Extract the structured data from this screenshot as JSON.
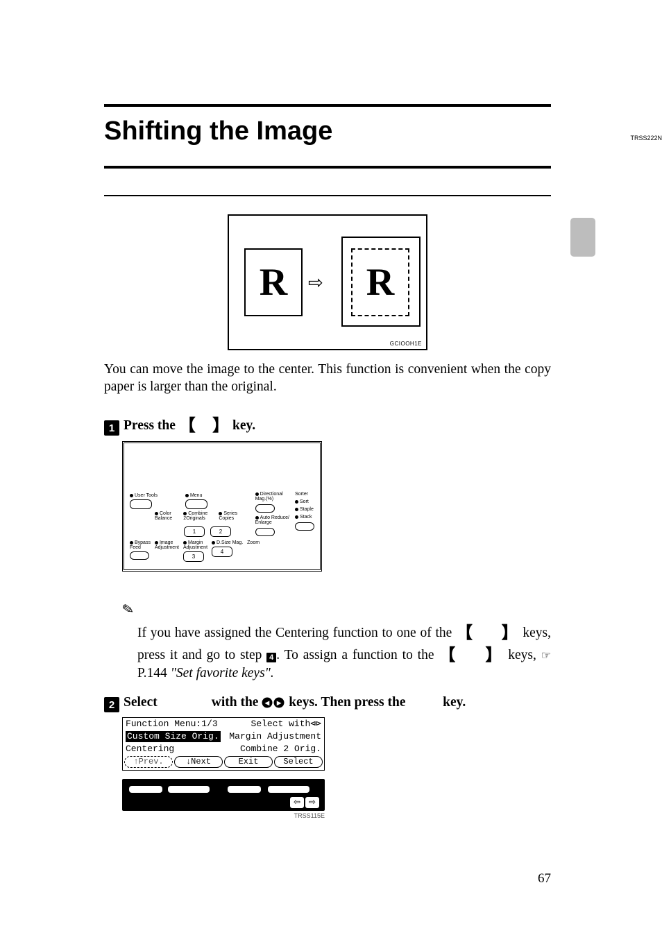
{
  "title": "Shifting the Image",
  "figure": {
    "letter_left": "R",
    "letter_right": "R",
    "code": "GCIOOH1E"
  },
  "intro": "You can move the image to the center. This function is convenient when the copy paper is larger than the original.",
  "step1": {
    "num": "1",
    "prefix": "Press the ",
    "suffix": " key."
  },
  "panel_code": "TRSS222N",
  "panel": {
    "user_tools": "User Tools",
    "menu": "Menu",
    "color_balance": "Color\nBalance",
    "combine": "Combine\n2Originals",
    "series": "Series\nCopies",
    "bypass": "Bypass\nFeed",
    "image_adj": "Image\nAdjustment",
    "margin_adj": "Margin\nAdjustment",
    "dsize": "D.Size Mag.",
    "n1": "1",
    "n2": "2",
    "n3": "3",
    "n4": "4",
    "directional": "Directional\nMag.(%)",
    "auto_reduce": "Auto Reduce/\nEnlarge",
    "zoom": "Zoom",
    "sorter": "Sorter",
    "sort": "Sort",
    "staple": "Staple",
    "stack": "Stack"
  },
  "note": {
    "line1a": "If you have assigned the Centering function to one of the ",
    "line1b": " keys,",
    "line2a": "press it and go to step ",
    "step_ref": "4",
    "line2b": ". To assign a function to the ",
    "line2c": " keys,",
    "page_ref": "P.144",
    "line3": "\"Set favorite keys\"."
  },
  "step2": {
    "num": "2",
    "t1": "Select ",
    "t2": " with the ",
    "t3": " keys. Then press the ",
    "t4": " key."
  },
  "lcd": {
    "header_left": "Function Menu:1/3",
    "header_right": "Select with",
    "row1_left": "Custom Size Orig.",
    "row1_right": "Margin Adjustment",
    "row2_left": "Centering",
    "row2_right": "Combine 2 Orig.",
    "btn_prev": "↑Prev.",
    "btn_next": "↓Next",
    "btn_exit": "Exit",
    "btn_select": "Select"
  },
  "hw_code": "TRSS115E",
  "page_number": "67"
}
